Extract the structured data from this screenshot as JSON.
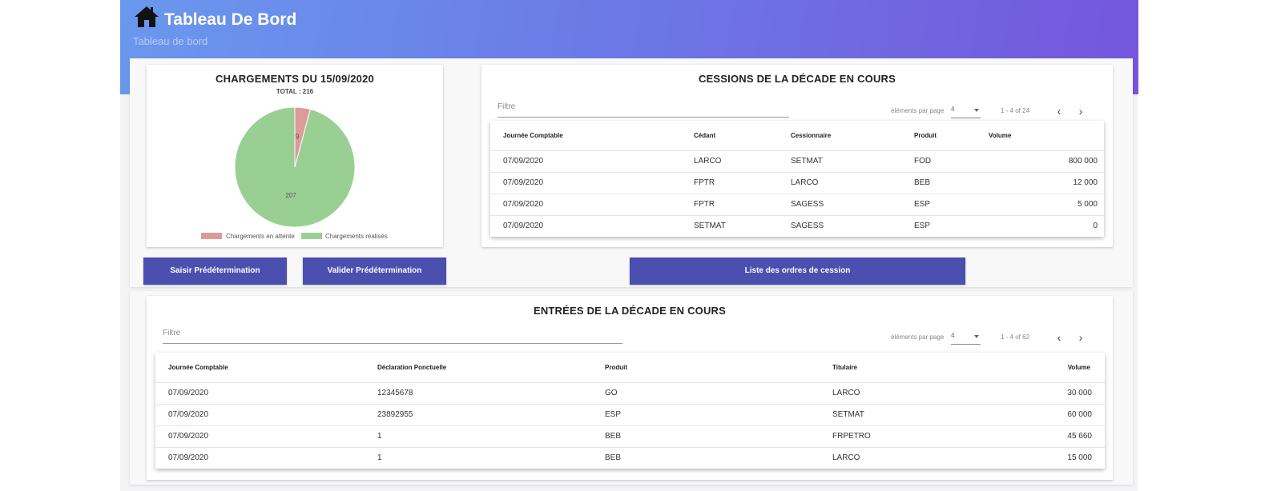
{
  "header": {
    "title": "Tableau De Bord",
    "breadcrumb": "Tableau de bord"
  },
  "chargements": {
    "title": "CHARGEMENTS DU 15/09/2020",
    "total": "TOTAL : 216",
    "chart_data": {
      "type": "pie",
      "categories": [
        "Chargements en attente",
        "Chargements réalisés"
      ],
      "values": [
        9,
        207
      ],
      "labels": [
        "9",
        "207"
      ],
      "colors": [
        "#dd9a9a",
        "#99cf93"
      ]
    }
  },
  "cessions": {
    "title": "CESSIONS DE LA DÉCADE EN COURS",
    "filter_placeholder": "Filtre",
    "per_page_label": "éléments par page",
    "page_size": "4",
    "range": "1 - 4 of 24",
    "columns": [
      "Journée Comptable",
      "Cédant",
      "Cessionnaire",
      "Produit",
      "Volume"
    ],
    "rows": [
      [
        "07/09/2020",
        "LARCO",
        "SETMAT",
        "FOD",
        "800 000"
      ],
      [
        "07/09/2020",
        "FPTR",
        "LARCO",
        "BEB",
        "12 000"
      ],
      [
        "07/09/2020",
        "FPTR",
        "SAGESS",
        "ESP",
        "5 000"
      ],
      [
        "07/09/2020",
        "SETMAT",
        "SAGESS",
        "ESP",
        "0"
      ]
    ]
  },
  "buttons": {
    "saisir": "Saisir Prédétermination",
    "valider": "Valider Prédétermination",
    "liste": "Liste des ordres de cession"
  },
  "entrees": {
    "title": "ENTRÉES DE LA DÉCADE EN COURS",
    "filter_placeholder": "Filtre",
    "per_page_label": "éléments par page",
    "page_size": "4",
    "range": "1 - 4 of 62",
    "columns": [
      "Journée Comptable",
      "Déclaration Ponctuelle",
      "Produit",
      "Titulaire",
      "Volume"
    ],
    "rows": [
      [
        "07/09/2020",
        "12345678",
        "GO",
        "LARCO",
        "30 000"
      ],
      [
        "07/09/2020",
        "23892955",
        "ESP",
        "SETMAT",
        "60 000"
      ],
      [
        "07/09/2020",
        "1",
        "BEB",
        "FRPETRO",
        "45 660"
      ],
      [
        "07/09/2020",
        "1",
        "BEB",
        "LARCO",
        "15 000"
      ]
    ]
  },
  "icons": {
    "home": "home-icon",
    "prev": "chevron-left-icon",
    "next": "chevron-right-icon",
    "dropdown": "caret-down-icon"
  }
}
